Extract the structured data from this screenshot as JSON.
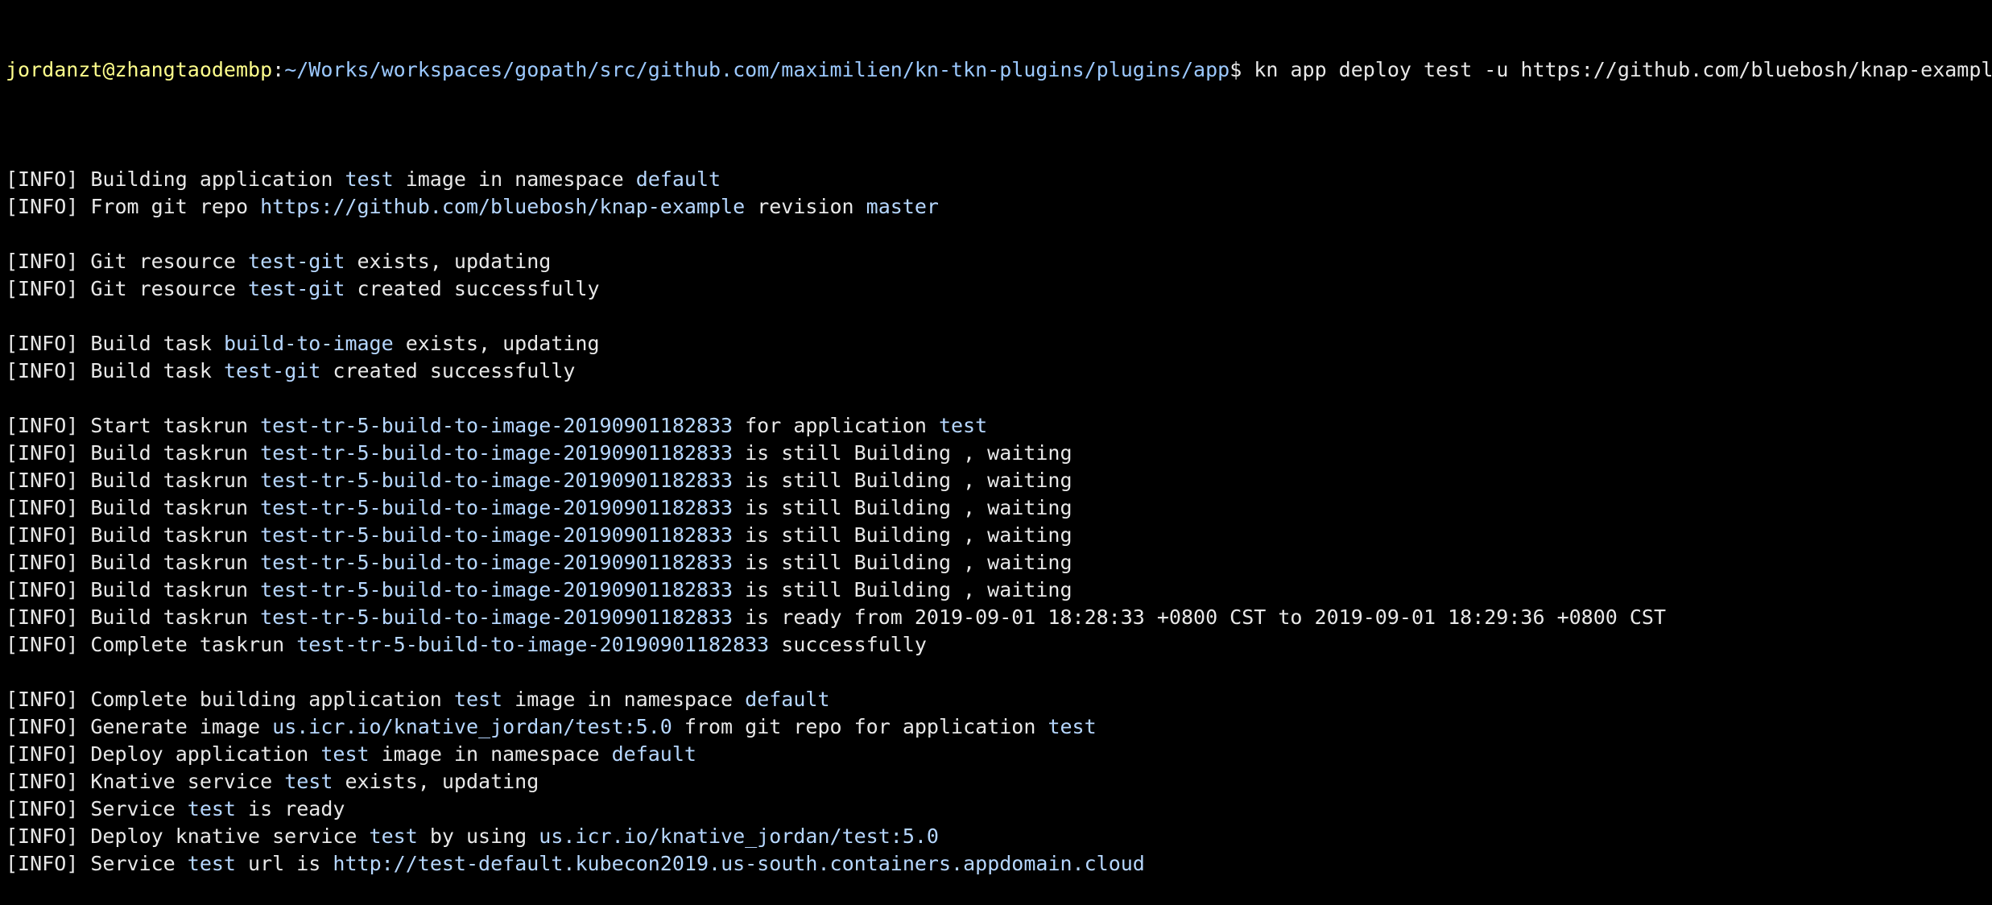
{
  "terminal": {
    "prompt": {
      "user_host": "jordanzt@zhangtaodembp",
      "separator": ":",
      "path": "~/Works/workspaces/gopath/src/github.com/maximilien/kn-tkn-plugins/plugins/app",
      "symbol": "$",
      "command": " kn app deploy test -u https://github.com/bluebosh/knap-example -r master"
    },
    "colors": {
      "background": "#000000",
      "text": "#e8e8e8",
      "prompt_user": "#ffff8c",
      "prompt_path": "#9cc9ff",
      "highlight": "#b6d7ff"
    },
    "lines": [
      {
        "type": "blank"
      },
      {
        "segments": [
          {
            "t": "[INFO] Building application "
          },
          {
            "t": "test",
            "hl": true
          },
          {
            "t": " image in namespace "
          },
          {
            "t": "default",
            "hl": true
          }
        ]
      },
      {
        "segments": [
          {
            "t": "[INFO] From git repo "
          },
          {
            "t": "https://github.com/bluebosh/knap-example",
            "hl": true
          },
          {
            "t": " revision "
          },
          {
            "t": "master",
            "hl": true
          }
        ]
      },
      {
        "type": "blank"
      },
      {
        "segments": [
          {
            "t": "[INFO] Git resource "
          },
          {
            "t": "test-git",
            "hl": true
          },
          {
            "t": " exists, updating"
          }
        ]
      },
      {
        "segments": [
          {
            "t": "[INFO] Git resource "
          },
          {
            "t": "test-git",
            "hl": true
          },
          {
            "t": " created successfully"
          }
        ]
      },
      {
        "type": "blank"
      },
      {
        "segments": [
          {
            "t": "[INFO] Build task "
          },
          {
            "t": "build-to-image",
            "hl": true
          },
          {
            "t": " exists, updating"
          }
        ]
      },
      {
        "segments": [
          {
            "t": "[INFO] Build task "
          },
          {
            "t": "test-git",
            "hl": true
          },
          {
            "t": " created successfully"
          }
        ]
      },
      {
        "type": "blank"
      },
      {
        "segments": [
          {
            "t": "[INFO] Start taskrun "
          },
          {
            "t": "test-tr-5-build-to-image-20190901182833",
            "hl": true
          },
          {
            "t": " for application "
          },
          {
            "t": "test",
            "hl": true
          }
        ]
      },
      {
        "segments": [
          {
            "t": "[INFO] Build taskrun "
          },
          {
            "t": "test-tr-5-build-to-image-20190901182833",
            "hl": true
          },
          {
            "t": " is still Building , waiting"
          }
        ]
      },
      {
        "segments": [
          {
            "t": "[INFO] Build taskrun "
          },
          {
            "t": "test-tr-5-build-to-image-20190901182833",
            "hl": true
          },
          {
            "t": " is still Building , waiting"
          }
        ]
      },
      {
        "segments": [
          {
            "t": "[INFO] Build taskrun "
          },
          {
            "t": "test-tr-5-build-to-image-20190901182833",
            "hl": true
          },
          {
            "t": " is still Building , waiting"
          }
        ]
      },
      {
        "segments": [
          {
            "t": "[INFO] Build taskrun "
          },
          {
            "t": "test-tr-5-build-to-image-20190901182833",
            "hl": true
          },
          {
            "t": " is still Building , waiting"
          }
        ]
      },
      {
        "segments": [
          {
            "t": "[INFO] Build taskrun "
          },
          {
            "t": "test-tr-5-build-to-image-20190901182833",
            "hl": true
          },
          {
            "t": " is still Building , waiting"
          }
        ]
      },
      {
        "segments": [
          {
            "t": "[INFO] Build taskrun "
          },
          {
            "t": "test-tr-5-build-to-image-20190901182833",
            "hl": true
          },
          {
            "t": " is still Building , waiting"
          }
        ]
      },
      {
        "segments": [
          {
            "t": "[INFO] Build taskrun "
          },
          {
            "t": "test-tr-5-build-to-image-20190901182833",
            "hl": true
          },
          {
            "t": " is ready from 2019-09-01 18:28:33 +0800 CST to 2019-09-01 18:29:36 +0800 CST"
          }
        ]
      },
      {
        "segments": [
          {
            "t": "[INFO] Complete taskrun "
          },
          {
            "t": "test-tr-5-build-to-image-20190901182833",
            "hl": true
          },
          {
            "t": " successfully"
          }
        ]
      },
      {
        "type": "blank"
      },
      {
        "segments": [
          {
            "t": "[INFO] Complete building application "
          },
          {
            "t": "test",
            "hl": true
          },
          {
            "t": " image in namespace "
          },
          {
            "t": "default",
            "hl": true
          }
        ]
      },
      {
        "segments": [
          {
            "t": "[INFO] Generate image "
          },
          {
            "t": "us.icr.io/knative_jordan/test:5.0",
            "hl": true
          },
          {
            "t": " from git repo for application "
          },
          {
            "t": "test",
            "hl": true
          }
        ]
      },
      {
        "segments": [
          {
            "t": "[INFO] Deploy application "
          },
          {
            "t": "test",
            "hl": true
          },
          {
            "t": " image in namespace "
          },
          {
            "t": "default",
            "hl": true
          }
        ]
      },
      {
        "segments": [
          {
            "t": "[INFO] Knative service "
          },
          {
            "t": "test",
            "hl": true
          },
          {
            "t": " exists, updating"
          }
        ]
      },
      {
        "segments": [
          {
            "t": "[INFO] Service "
          },
          {
            "t": "test",
            "hl": true
          },
          {
            "t": " is ready"
          }
        ]
      },
      {
        "segments": [
          {
            "t": "[INFO] Deploy knative service "
          },
          {
            "t": "test",
            "hl": true
          },
          {
            "t": " by using "
          },
          {
            "t": "us.icr.io/knative_jordan/test:5.0",
            "hl": true
          }
        ]
      },
      {
        "segments": [
          {
            "t": "[INFO] Service "
          },
          {
            "t": "test",
            "hl": true
          },
          {
            "t": " url is "
          },
          {
            "t": "http://test-default.kubecon2019.us-south.containers.appdomain.cloud",
            "hl": true
          }
        ]
      }
    ]
  }
}
